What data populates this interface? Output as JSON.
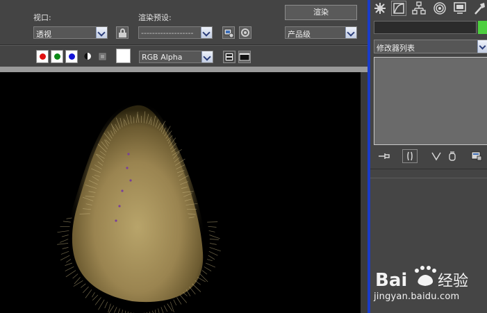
{
  "render_frame": {
    "viewport_label": "视口:",
    "viewport_value": "透视",
    "preset_label": "渲染预设:",
    "preset_value": "-------------------",
    "render_button": "渲染",
    "quality_value": "产品级",
    "channel_value": "RGB Alpha",
    "channel_colors": {
      "red": "#e01010",
      "green": "#0c8a18",
      "blue": "#1414d8"
    },
    "swatch_color": "#ffffff"
  },
  "command_panel": {
    "tabs": [
      "create-icon",
      "modify-icon",
      "hierarchy-icon",
      "motion-icon",
      "display-icon",
      "utilities-icon"
    ],
    "object_color": "#4dcf3f",
    "modifier_list": "修改器列表"
  },
  "watermark": {
    "brand": "Bai度经验",
    "url": "jingyan.baidu.com"
  }
}
